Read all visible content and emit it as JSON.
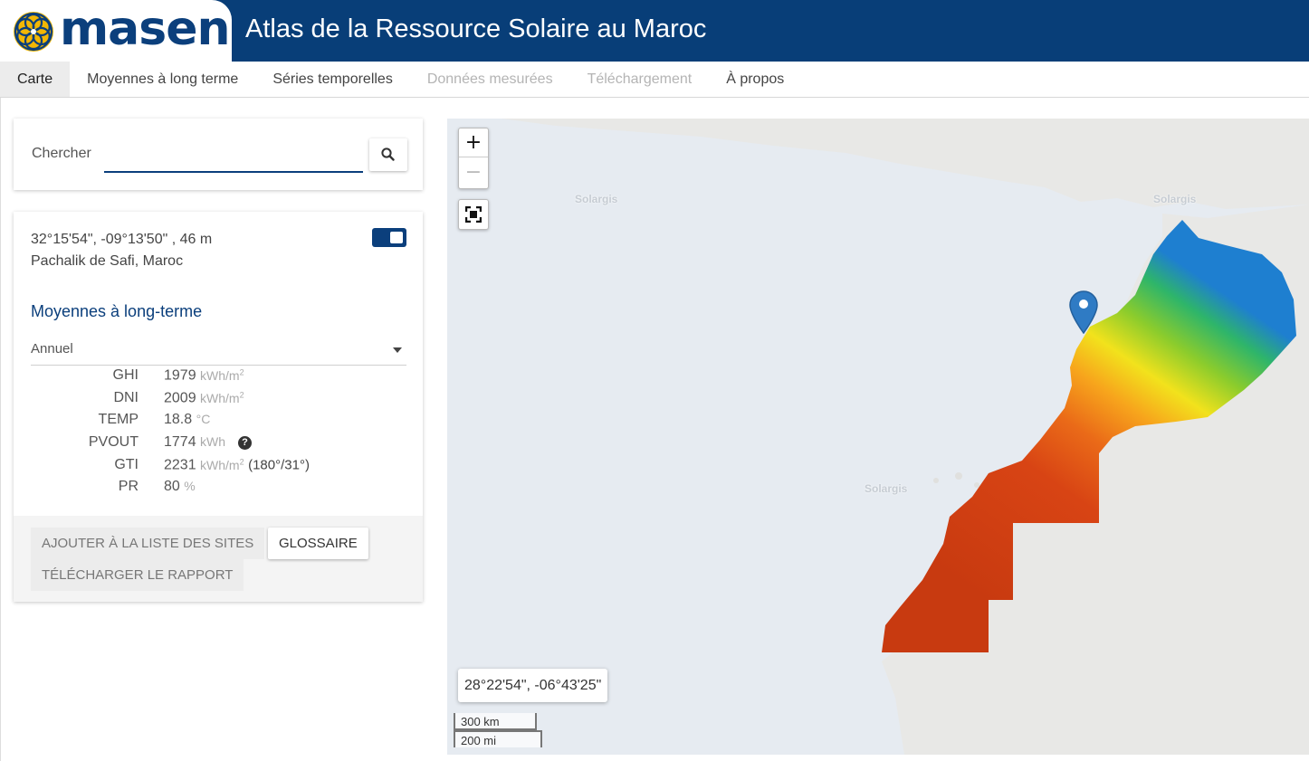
{
  "header": {
    "logo_text": "masen",
    "title": "Atlas de la Ressource Solaire au Maroc"
  },
  "nav": {
    "tabs": [
      {
        "label": "Carte"
      },
      {
        "label": "Moyennes à long terme"
      },
      {
        "label": "Séries temporelles"
      },
      {
        "label": "Données mesurées"
      },
      {
        "label": "Téléchargement"
      },
      {
        "label": "À propos"
      }
    ]
  },
  "search": {
    "label": "Chercher",
    "value": "",
    "icon": "search-icon"
  },
  "site": {
    "coords": "32°15'54\", -09°13'50\" , 46 m",
    "place": "Pachalik de Safi, Maroc",
    "section_title": "Moyennes à long-terme",
    "period": "Annuel"
  },
  "metrics": [
    {
      "label": "GHI",
      "value": "1979",
      "unit": "kWh/m",
      "sup": "2",
      "extra": ""
    },
    {
      "label": "DNI",
      "value": "2009",
      "unit": "kWh/m",
      "sup": "2",
      "extra": ""
    },
    {
      "label": "TEMP",
      "value": "18.8",
      "unit": "°C",
      "sup": "",
      "extra": ""
    },
    {
      "label": "PVOUT",
      "value": "1774",
      "unit": "kWh",
      "sup": "",
      "extra": ""
    },
    {
      "label": "GTI",
      "value": "2231",
      "unit": "kWh/m",
      "sup": "2",
      "extra": "(180°/31°)"
    },
    {
      "label": "PR",
      "value": "80",
      "unit": "%",
      "sup": "",
      "extra": ""
    }
  ],
  "actions": {
    "add_to_list": "AJOUTER À LA LISTE DES SITES",
    "glossary": "GLOSSAIRE",
    "download_report": "TÉLÉCHARGER LE RAPPORT"
  },
  "map": {
    "zoom_in": "+",
    "zoom_out": "−",
    "cursor_coords": "28°22'54\", -06°43'25\"",
    "scale_km": "300 km",
    "scale_mi": "200 mi",
    "watermark": "Solargis",
    "colors": {
      "water": "#e6ebf1",
      "land": "#e8e8e6",
      "marker": "#2f7bc4",
      "brand": "#083e78"
    }
  }
}
